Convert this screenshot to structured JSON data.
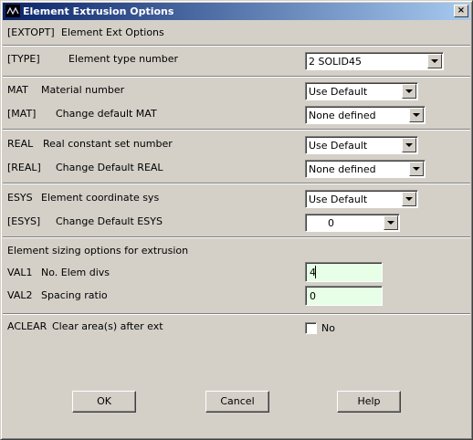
{
  "window": {
    "title": "Element Extrusion Options",
    "close_symbol": "×"
  },
  "header": {
    "command": "[EXTOPT]",
    "description": "Element Ext Options"
  },
  "type_row": {
    "code": "[TYPE]",
    "label": "Element type number",
    "value": "2    SOLID45"
  },
  "mat": {
    "row1": {
      "code": "MAT",
      "label": "Material number",
      "value": "Use Default"
    },
    "row2": {
      "code": "[MAT]",
      "label": "Change default MAT",
      "value": "None defined"
    }
  },
  "real": {
    "row1": {
      "code": "REAL",
      "label": "Real constant set number",
      "value": "Use Default"
    },
    "row2": {
      "code": "[REAL]",
      "label": "Change Default REAL",
      "value": "None defined"
    }
  },
  "esys": {
    "row1": {
      "code": "ESYS",
      "label": "Element coordinate sys",
      "value": "Use Default"
    },
    "row2": {
      "code": "[ESYS]",
      "label": "Change Default ESYS",
      "value": "0"
    }
  },
  "sizing": {
    "heading": "Element sizing options for extrusion",
    "val1": {
      "code": "VAL1",
      "label": "No. Elem divs",
      "value": "4"
    },
    "val2": {
      "code": "VAL2",
      "label": "Spacing ratio",
      "value": "0"
    }
  },
  "aclear": {
    "code": "ACLEAR",
    "label": "Clear area(s) after ext",
    "checked": false,
    "check_label": "No"
  },
  "buttons": {
    "ok": "OK",
    "cancel": "Cancel",
    "help": "Help"
  }
}
